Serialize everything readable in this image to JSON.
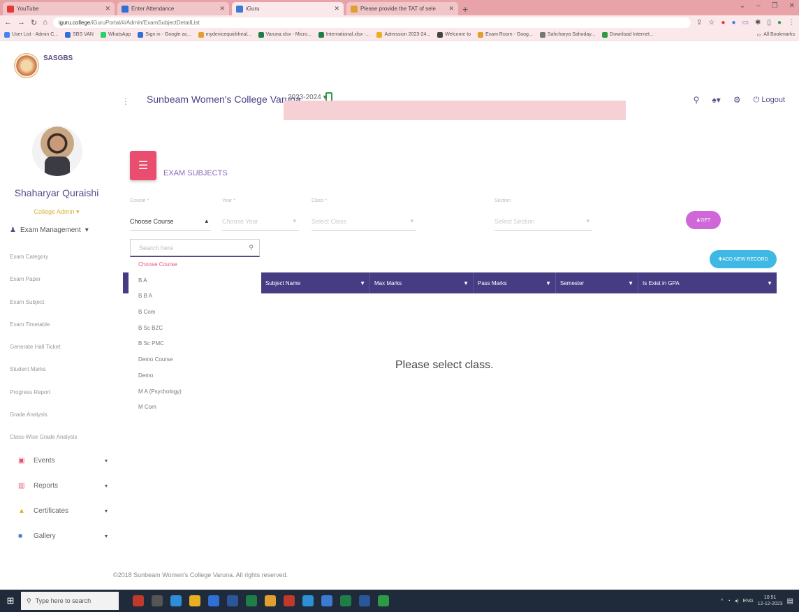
{
  "browser": {
    "tabs": [
      {
        "title": "YouTube",
        "favicon_color": "#e53935",
        "active": false
      },
      {
        "title": "Enter Attendance",
        "favicon_color": "#2f6fd6",
        "active": false
      },
      {
        "title": "iGuru",
        "favicon_color": "#3b7bd4",
        "active": true
      },
      {
        "title": "Please provide the TAT of sele",
        "favicon_color": "#e0a030",
        "active": false
      }
    ],
    "url_host": "iguru.college",
    "url_path": "/iGuruPortal/#/Admin/ExamSubjectDetailList",
    "bookmarks": [
      "User List - Admin C...",
      "SBS VAN",
      "WhatsApp",
      "Sign in - Google ac...",
      "mydevicequickheal...",
      "Varuna.xlsx - Micro...",
      "International.xlsx -...",
      "Admission 2023-24...",
      "Welcome to",
      "Exam Room - Goog...",
      "Sahcharya Sahoday...",
      "Download Internet..."
    ],
    "bookmarks_right": "All Bookmarks"
  },
  "sidebar": {
    "brand": "SASGBS",
    "user_name": "Shaharyar Quraishi",
    "user_role": "College Admin",
    "group_label": "Exam Management",
    "items": [
      "Exam Category",
      "Exam Paper",
      "Exam Subject",
      "Exam Timetable",
      "Generate Hall Ticket",
      "Student Marks",
      "Progress Report",
      "Grade Analysis",
      "Class-Wise Grade Analysis"
    ],
    "sections": [
      {
        "label": "Events",
        "icon": "calendar-icon",
        "color": "#e94e6f"
      },
      {
        "label": "Reports",
        "icon": "chart-icon",
        "color": "#e94e6f"
      },
      {
        "label": "Certificates",
        "icon": "certificate-icon",
        "color": "#e8b020"
      },
      {
        "label": "Gallery",
        "icon": "gallery-icon",
        "color": "#3b7bd4"
      }
    ]
  },
  "header": {
    "college": "Sunbeam Women's College Varuna",
    "year": "2023-2024",
    "logout": "Logout"
  },
  "page": {
    "title": "EXAM SUBJECTS",
    "filters": [
      {
        "label": "Course *",
        "value": "Choose Course"
      },
      {
        "label": "Year *",
        "value": "Choose Year"
      },
      {
        "label": "Class *",
        "value": "Select Class"
      },
      {
        "label": "Section",
        "value": "Select Section"
      }
    ],
    "get_button": "GET",
    "add_button": "ADD NEW RECORD",
    "search_placeholder": "Search here",
    "course_options": [
      "Choose Course",
      "B A",
      "B B A",
      "B Com",
      "B Sc BZC",
      "B Sc PMC",
      "Demo Course",
      "Demo",
      "M A (Psychology)",
      "M Com"
    ],
    "columns": [
      "Subject Name",
      "Max Marks",
      "Pass Marks",
      "Semester",
      "Is Exist in GPA"
    ],
    "empty_message": "Please select class.",
    "footer": "©2018 Sunbeam Women's College Varuna. All rights reserved."
  },
  "taskbar": {
    "search_placeholder": "Type here to search",
    "time": "10:51",
    "date": "12-12-2023",
    "lang": "ENG"
  }
}
